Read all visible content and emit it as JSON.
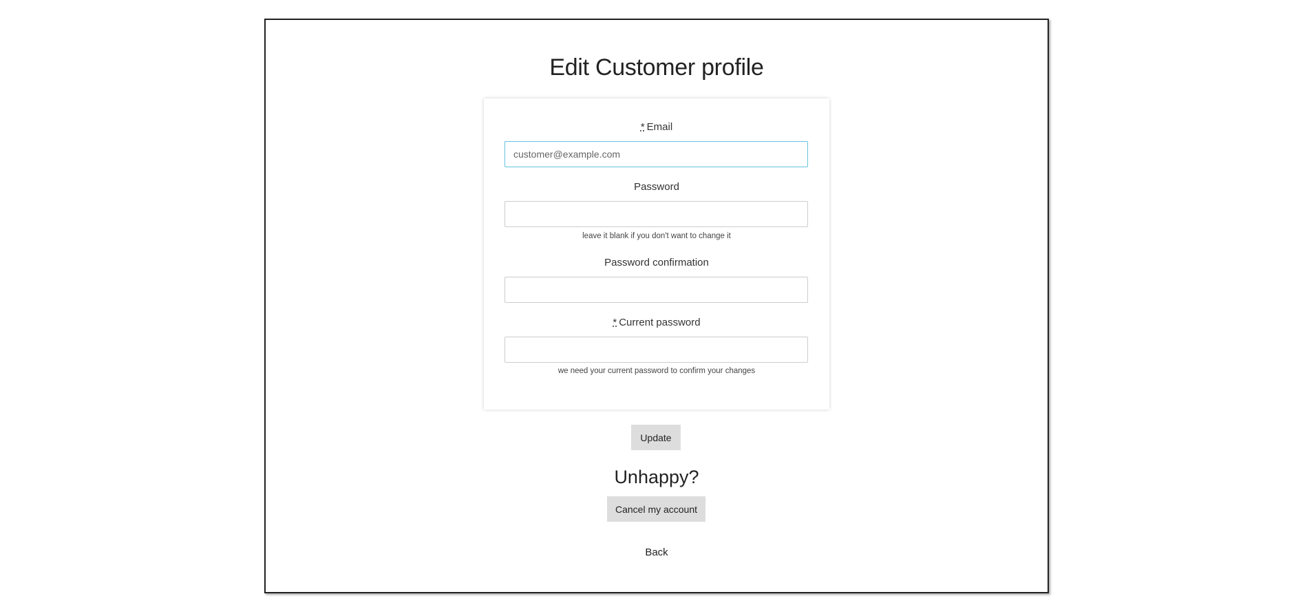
{
  "page": {
    "title": "Edit Customer profile"
  },
  "form": {
    "required_marker": "*",
    "email": {
      "label": "Email",
      "value": "",
      "placeholder": "customer@example.com"
    },
    "password": {
      "label": "Password",
      "value": "",
      "hint": "leave it blank if you don't want to change it"
    },
    "password_confirmation": {
      "label": "Password confirmation",
      "value": ""
    },
    "current_password": {
      "label": "Current password",
      "value": "",
      "hint": "we need your current password to confirm your changes"
    },
    "update_label": "Update"
  },
  "cancel_section": {
    "heading": "Unhappy?",
    "cancel_label": "Cancel my account"
  },
  "nav": {
    "back_label": "Back"
  },
  "colors": {
    "button_bg": "#dddddd",
    "focus_border": "#66c2e0",
    "frame_border": "#222222"
  }
}
